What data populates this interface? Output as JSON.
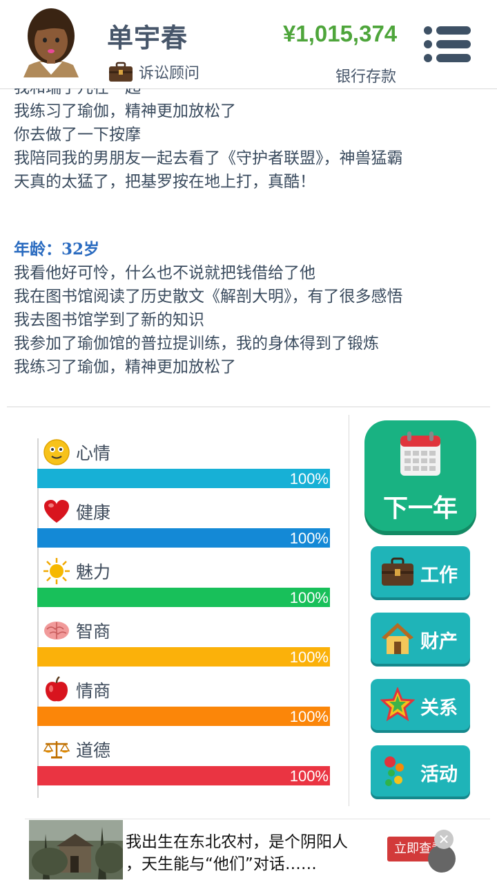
{
  "header": {
    "name": "单宇春",
    "job": "诉讼顾问",
    "money": "¥1,015,374",
    "money_label": "银行存款"
  },
  "log": {
    "cut_line": "我和瑞了儿在一起",
    "lines_before": [
      "我练习了瑜伽，精神更加放松了",
      "你去做了一下按摩",
      "我陪同我的男朋友一起去看了《守护者联盟》，神兽猛霸",
      "天真的太猛了，把基罗按在地上打，真酷！"
    ],
    "age_label": "年龄：32岁",
    "lines_after": [
      "我看他好可怜，什么也不说就把钱借给了他",
      "我在图书馆阅读了历史散文《解剖大明》，有了很多感悟",
      "我去图书馆学到了新的知识",
      "我参加了瑜伽馆的普拉提训练，我的身体得到了锻炼",
      "我练习了瑜伽，精神更加放松了"
    ]
  },
  "stats": [
    {
      "label": "心情",
      "percent": "100%",
      "value": 1.0,
      "color": "#17b0d6",
      "icon": "smiley-icon"
    },
    {
      "label": "健康",
      "percent": "100%",
      "value": 1.0,
      "color": "#1489d6",
      "icon": "heart-icon"
    },
    {
      "label": "魅力",
      "percent": "100%",
      "value": 1.0,
      "color": "#18c05a",
      "icon": "sun-icon"
    },
    {
      "label": "智商",
      "percent": "100%",
      "value": 1.0,
      "color": "#fbb10a",
      "icon": "brain-icon"
    },
    {
      "label": "情商",
      "percent": "100%",
      "value": 1.0,
      "color": "#fb8609",
      "icon": "apple-icon"
    },
    {
      "label": "道德",
      "percent": "100%",
      "value": 1.0,
      "color": "#ea3442",
      "icon": "scales-icon"
    }
  ],
  "actions": {
    "next_year": "下一年",
    "work": "工作",
    "property": "财产",
    "relations": "关系",
    "activities": "活动"
  },
  "ad": {
    "line1": "我出生在东北农村，是个阴阳人",
    "line2": "，天生能与“他们”对话……",
    "cta": "立即查看",
    "close": "✕"
  }
}
